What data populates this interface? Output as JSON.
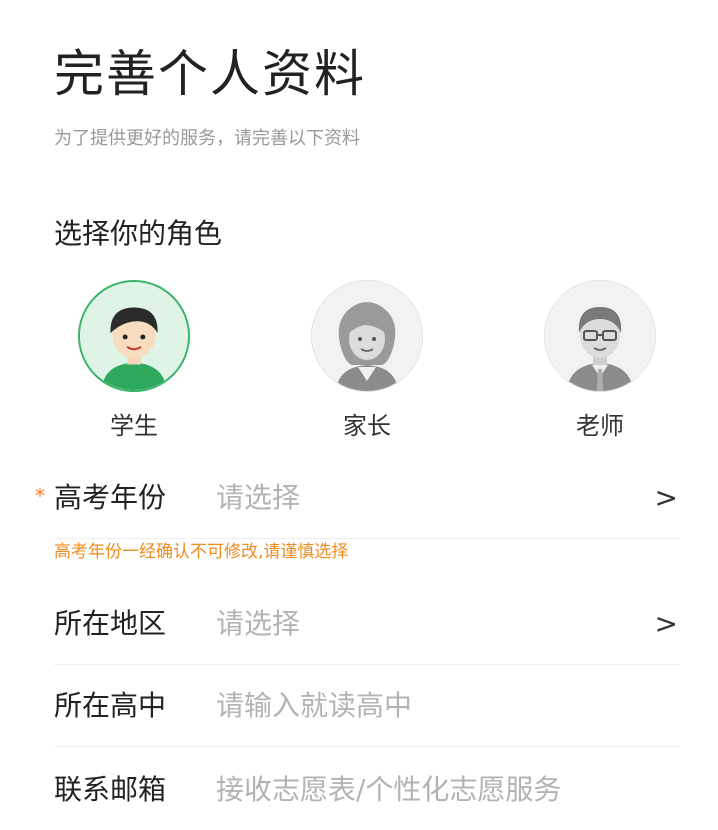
{
  "header": {
    "title": "完善个人资料",
    "subtitle": "为了提供更好的服务，请完善以下资料"
  },
  "roles": {
    "section_title": "选择你的角色",
    "items": [
      {
        "label": "学生",
        "selected": true
      },
      {
        "label": "家长",
        "selected": false
      },
      {
        "label": "老师",
        "selected": false
      }
    ]
  },
  "form": {
    "required_mark": "*",
    "year": {
      "label": "高考年份",
      "placeholder": "请选择",
      "hint": "高考年份一经确认不可修改,请谨慎选择",
      "chevron": ">"
    },
    "region": {
      "label": "所在地区",
      "placeholder": "请选择",
      "chevron": ">"
    },
    "school": {
      "label": "所在高中",
      "placeholder": "请输入就读高中"
    },
    "email": {
      "label": "联系邮箱",
      "placeholder": "接收志愿表/个性化志愿服务"
    }
  },
  "colors": {
    "accent": "#37b46a",
    "warning": "#f08b1f",
    "required": "#ff7a1a",
    "placeholder": "#b3b3b3"
  }
}
